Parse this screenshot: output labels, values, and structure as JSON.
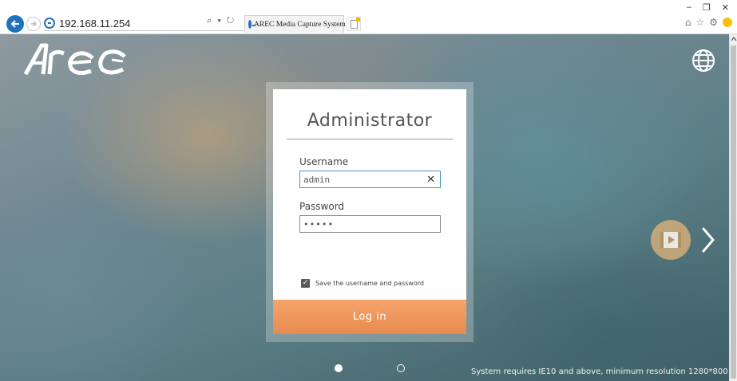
{
  "browser": {
    "address": "192.168.11.254",
    "address_tools": "⌕ ▾ ↻",
    "tab_title": "AREC Media Capture System",
    "tab_close": "×",
    "minimize": "–",
    "restore": "❐",
    "close": "✕",
    "icons": [
      "back-icon",
      "forward-icon",
      "ie-icon",
      "search-icon",
      "refresh-icon",
      "home-icon",
      "favorites-icon",
      "settings-icon",
      "feedback-icon"
    ]
  },
  "brand": {
    "logo_text": "Arec"
  },
  "login": {
    "title": "Administrator",
    "username_label": "Username",
    "username_value": "admin",
    "clear_symbol": "✕",
    "password_label": "Password",
    "password_value": "•••••",
    "save_label": "Save the username and password",
    "save_checked": true,
    "submit_label": "Log in"
  },
  "carousel": {
    "slide_count": 2,
    "active_slide": 1
  },
  "footer": {
    "requirement": "System requires IE10 and above, minimum resolution 1280*800"
  },
  "colors": {
    "accent": "#ee9358",
    "browser_blue": "#1e73be",
    "video_badge": "#c8a97a"
  }
}
